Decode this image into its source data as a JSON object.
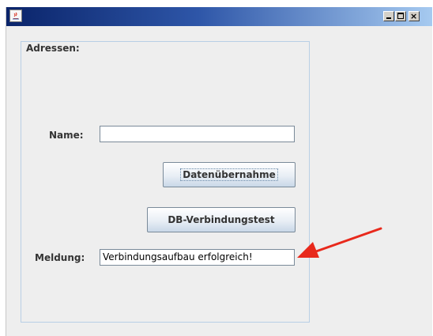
{
  "window": {
    "title": "",
    "controls": [
      "minimize",
      "maximize",
      "close"
    ],
    "close_glyph": "×"
  },
  "form": {
    "group_title": "Adressen:",
    "name_label": "Name:",
    "name_value": "",
    "button_transfer": "Datenübernahme",
    "button_db_test": "DB-Verbindungstest",
    "message_label": "Meldung:",
    "message_value": "Verbindungsaufbau erfolgreich!"
  },
  "annotation": {
    "arrow_color": "#e8291c"
  }
}
